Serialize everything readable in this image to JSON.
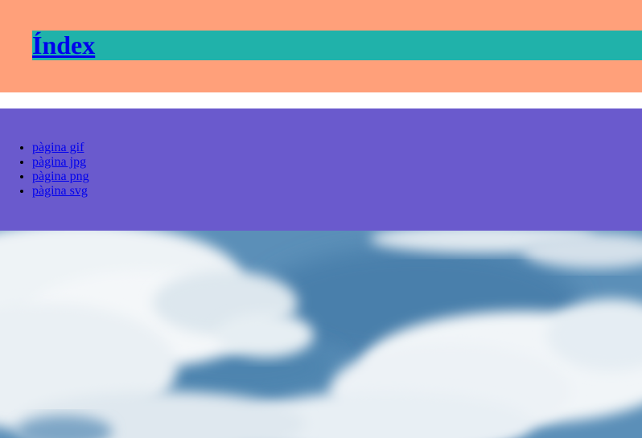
{
  "header": {
    "title": "Índex"
  },
  "nav": {
    "items": [
      {
        "label": "pàgina gif"
      },
      {
        "label": "pàgina jpg"
      },
      {
        "label": "pàgina png"
      },
      {
        "label": "pàgina svg"
      }
    ]
  },
  "colors": {
    "header_bg": "#ffa07a",
    "title_bar_bg": "#20b2aa",
    "nav_bg": "#6a5acd",
    "link": "#0000ee"
  },
  "background_image": {
    "subject": "cloudy-sky-image"
  }
}
